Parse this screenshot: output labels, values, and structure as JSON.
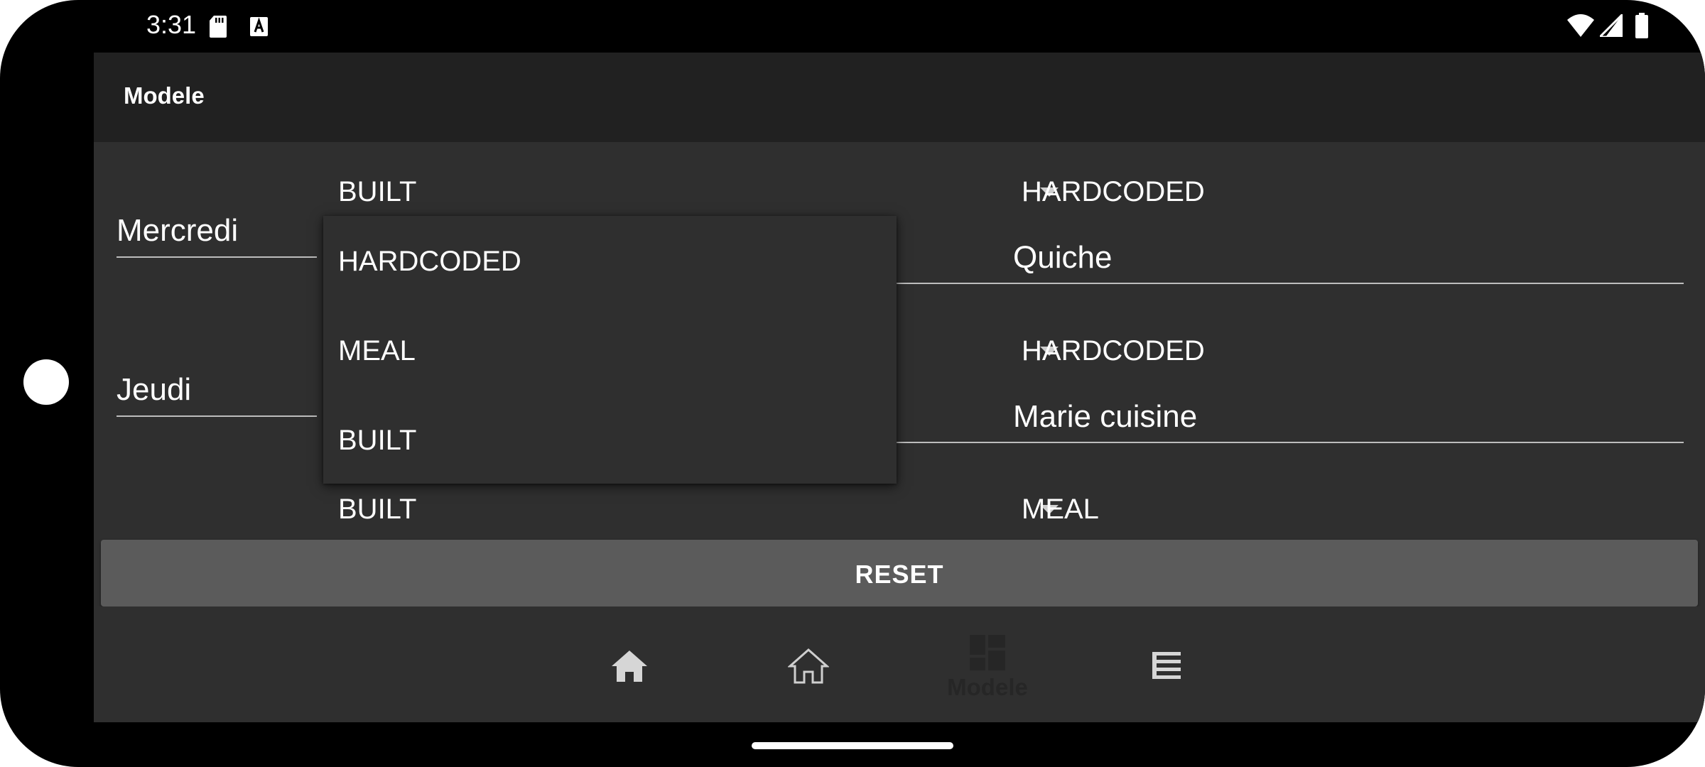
{
  "status_bar": {
    "time": "3:31",
    "icons": [
      "sd-card-icon",
      "text-a-icon",
      "wifi-icon",
      "signal-icon",
      "battery-icon"
    ]
  },
  "app_bar": {
    "title": "Modele"
  },
  "rows": [
    {
      "day": "Mercredi",
      "left_spinner": "BUILT",
      "left_field": "",
      "right_spinner": "HARDCODED",
      "right_field": "Quiche"
    },
    {
      "day": "Jeudi",
      "left_spinner": "",
      "left_field": "",
      "right_spinner": "HARDCODED",
      "right_field": "Marie cuisine"
    },
    {
      "day": "",
      "left_spinner": "BUILT",
      "right_spinner": "MEAL"
    }
  ],
  "dropdown": {
    "options": [
      "HARDCODED",
      "MEAL",
      "BUILT"
    ]
  },
  "reset_button": {
    "label": "RESET"
  },
  "bottom_nav": {
    "items": [
      {
        "icon": "home-filled-icon",
        "label": ""
      },
      {
        "icon": "home-outline-icon",
        "label": ""
      },
      {
        "icon": "dashboard-icon",
        "label": "Modele"
      },
      {
        "icon": "list-icon",
        "label": ""
      }
    ]
  },
  "colors": {
    "background": "#2f2f2f",
    "app_bar": "#212121",
    "button": "#5b5b5b",
    "text": "#ffffff",
    "underline": "#bdbdbd"
  }
}
